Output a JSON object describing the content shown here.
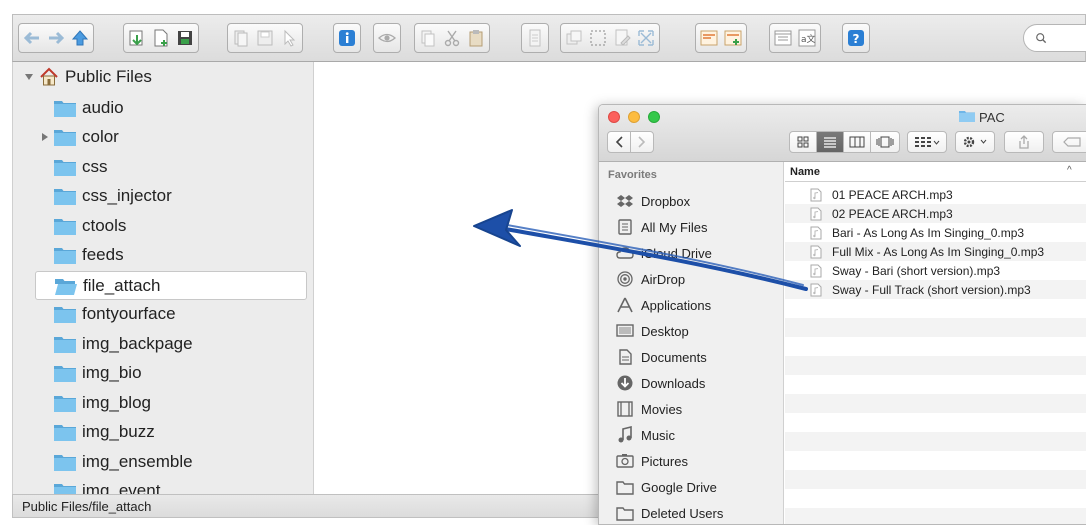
{
  "toolbar": {
    "groups": [
      [
        "back-arrow-icon",
        "forward-arrow-icon",
        "up-arrow-icon"
      ],
      [
        "download-icon",
        "new-file-icon",
        "save-icon"
      ],
      [
        "copy-page-icon",
        "floppy-icon",
        "pointer-icon"
      ],
      [
        "info-icon"
      ],
      [
        "eye-icon"
      ],
      [
        "duplicate-icon",
        "scissors-icon",
        "clipboard-icon"
      ],
      [
        "document-icon"
      ],
      [
        "layers-icon",
        "selection-icon",
        "edit-page-icon",
        "resize-icon"
      ],
      [
        "panel-icon",
        "panel-add-icon"
      ],
      [
        "window-icon",
        "translate-icon"
      ],
      [
        "help-icon"
      ]
    ],
    "search_icon": "magnifier-icon"
  },
  "tree": {
    "root_label": "Public Files",
    "items": [
      {
        "label": "audio",
        "expandable": false
      },
      {
        "label": "color",
        "expandable": true
      },
      {
        "label": "css",
        "expandable": false
      },
      {
        "label": "css_injector",
        "expandable": false
      },
      {
        "label": "ctools",
        "expandable": false
      },
      {
        "label": "feeds",
        "expandable": false
      },
      {
        "label": "file_attach",
        "expandable": false,
        "selected": true
      },
      {
        "label": "fontyourface",
        "expandable": false
      },
      {
        "label": "img_backpage",
        "expandable": false
      },
      {
        "label": "img_bio",
        "expandable": false
      },
      {
        "label": "img_blog",
        "expandable": false
      },
      {
        "label": "img_buzz",
        "expandable": false
      },
      {
        "label": "img_ensemble",
        "expandable": false
      },
      {
        "label": "img_event",
        "expandable": false
      }
    ]
  },
  "status": {
    "path": "Public Files/file_attach"
  },
  "finder": {
    "title": "PAC",
    "sidebar_heading": "Favorites",
    "favorites": [
      {
        "label": "Dropbox",
        "icon": "dropbox-icon"
      },
      {
        "label": "All My Files",
        "icon": "all-files-icon"
      },
      {
        "label": "iCloud Drive",
        "icon": "cloud-icon"
      },
      {
        "label": "AirDrop",
        "icon": "airdrop-icon"
      },
      {
        "label": "Applications",
        "icon": "applications-icon"
      },
      {
        "label": "Desktop",
        "icon": "desktop-icon"
      },
      {
        "label": "Documents",
        "icon": "documents-icon"
      },
      {
        "label": "Downloads",
        "icon": "downloads-icon"
      },
      {
        "label": "Movies",
        "icon": "movies-icon"
      },
      {
        "label": "Music",
        "icon": "music-icon"
      },
      {
        "label": "Pictures",
        "icon": "pictures-icon"
      },
      {
        "label": "Google Drive",
        "icon": "folder-icon"
      },
      {
        "label": "Deleted Users",
        "icon": "folder-icon"
      }
    ],
    "column_name": "Name",
    "sort_indicator": "^",
    "files": [
      "01 PEACE ARCH.mp3",
      "02 PEACE ARCH.mp3",
      "Bari - As Long As Im Singing_0.mp3",
      "Full Mix -  As Long As Im Singing_0.mp3",
      "Sway - Bari (short version).mp3",
      "Sway - Full Track (short version).mp3"
    ]
  },
  "colors": {
    "folder": "#7cc4ee",
    "folder_dark": "#5aa7d8",
    "arrow": "#1d4fa8",
    "traffic_red": "#fc605c",
    "traffic_yellow": "#fdbc40",
    "traffic_green": "#34c84a"
  }
}
